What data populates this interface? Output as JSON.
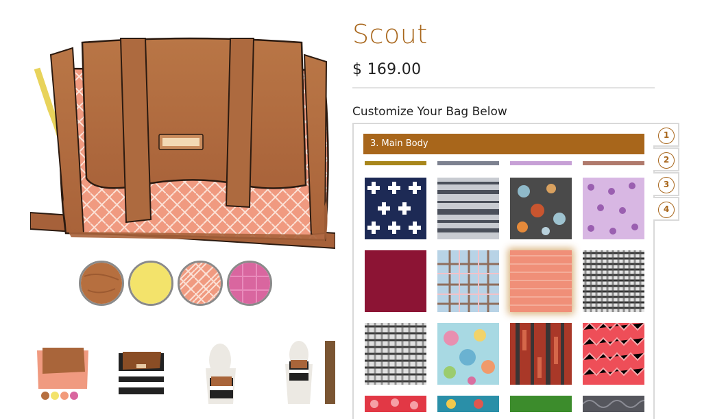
{
  "product": {
    "title": "Scout",
    "price": "$ 169.00"
  },
  "customizer": {
    "heading": "Customize Your Bag Below",
    "current_step": "3. Main Body",
    "steps": [
      "1",
      "2",
      "3",
      "4"
    ]
  },
  "swatches": [
    {
      "name": "leather-brown",
      "color": "#b66f3f"
    },
    {
      "name": "yellow",
      "color": "#f3e36b"
    },
    {
      "name": "coral-herringbone",
      "color": "#f29a7a"
    },
    {
      "name": "pink-plaid",
      "color": "#d9669f"
    }
  ],
  "fabrics": [
    {
      "name": "navy-swiss-cross",
      "color": "#1d2a55"
    },
    {
      "name": "gray-stripe",
      "color": "#9fa3ab"
    },
    {
      "name": "dark-floral",
      "color": "#4a4a4a"
    },
    {
      "name": "lilac-print",
      "color": "#c7a0d6"
    },
    {
      "name": "burgundy",
      "color": "#8c1434"
    },
    {
      "name": "blue-plaid",
      "color": "#a6c7de"
    },
    {
      "name": "coral-herringbone",
      "color": "#f08f78"
    },
    {
      "name": "black-gingham",
      "color": "#d7d7d7"
    },
    {
      "name": "black-gingham-2",
      "color": "#cfcfcf"
    },
    {
      "name": "aqua-floral",
      "color": "#a8d9e3"
    },
    {
      "name": "rust-ikat",
      "color": "#a93828"
    },
    {
      "name": "red-herringbone",
      "color": "#ee4e58"
    },
    {
      "name": "red-floral",
      "color": "#e23845"
    },
    {
      "name": "teal-paisley",
      "color": "#2a8fa8"
    },
    {
      "name": "green",
      "color": "#3c8c2c"
    },
    {
      "name": "gray-lace",
      "color": "#55565d"
    }
  ],
  "colors": {
    "accent": "#a8661b",
    "leather": "#b66f3f",
    "selected_fabric": "#f08f78"
  }
}
